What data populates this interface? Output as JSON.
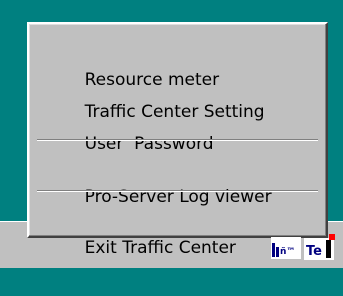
{
  "menu": {
    "items": [
      {
        "label": "Resource meter"
      },
      {
        "label": "Traffic Center Setting"
      },
      {
        "label": "User  Password"
      },
      {
        "label": "Pro-Server Log viewer"
      },
      {
        "label": "Exit Traffic Center"
      }
    ]
  },
  "tray": {
    "icons": [
      {
        "name": "tray-app-icon-1",
        "text": "ñ™"
      },
      {
        "name": "tray-traffic-center-icon",
        "text": "Te"
      }
    ]
  },
  "colors": {
    "desktop": "#008080",
    "menu_bg": "#c0c0c0",
    "tray_icon_blue": "#000080",
    "tray_icon_red": "#ff0000"
  }
}
